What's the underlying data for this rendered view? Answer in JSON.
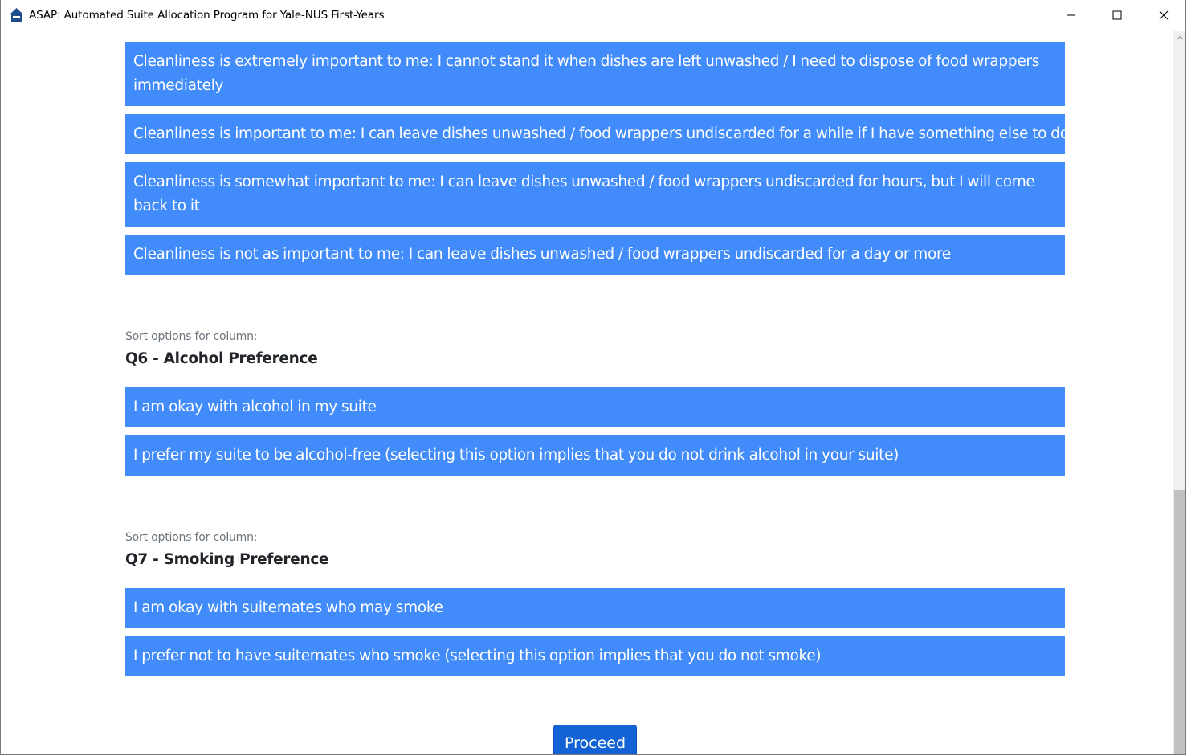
{
  "window": {
    "title": "ASAP: Automated Suite Allocation Program for Yale-NUS First-Years",
    "icon": "house-icon",
    "controls": [
      "minimize-icon",
      "maximize-icon",
      "close-icon"
    ]
  },
  "q5_options": [
    {
      "label": "Cleanliness is extremely important to me: I cannot stand it when dishes are left unwashed / I need to dispose of food wrappers immediately"
    },
    {
      "label": "Cleanliness is important to me: I can leave dishes unwashed / food wrappers undiscarded for a while if I have something else to do"
    },
    {
      "label": "Cleanliness is somewhat important to me: I can leave dishes unwashed / food wrappers undiscarded for hours, but I will come back to it"
    },
    {
      "label": "Cleanliness is not as important to me: I can leave dishes unwashed / food wrappers undiscarded for a day or more"
    }
  ],
  "q6": {
    "sort_label": "Sort options for column:",
    "title": "Q6 - Alcohol Preference",
    "options": [
      {
        "label": "I am okay with alcohol in my suite"
      },
      {
        "label": "I prefer my suite to be alcohol-free (selecting this option implies that you do not drink alcohol in your suite)"
      }
    ]
  },
  "q7": {
    "sort_label": "Sort options for column:",
    "title": "Q7 - Smoking Preference",
    "options": [
      {
        "label": "I am okay with suitemates who may smoke"
      },
      {
        "label": "I prefer not to have suitemates who smoke (selecting this option implies that you do not smoke)"
      }
    ]
  },
  "proceed_label": "Proceed",
  "colors": {
    "option_bg": "#428bfa",
    "proceed_bg": "#1463d6"
  }
}
